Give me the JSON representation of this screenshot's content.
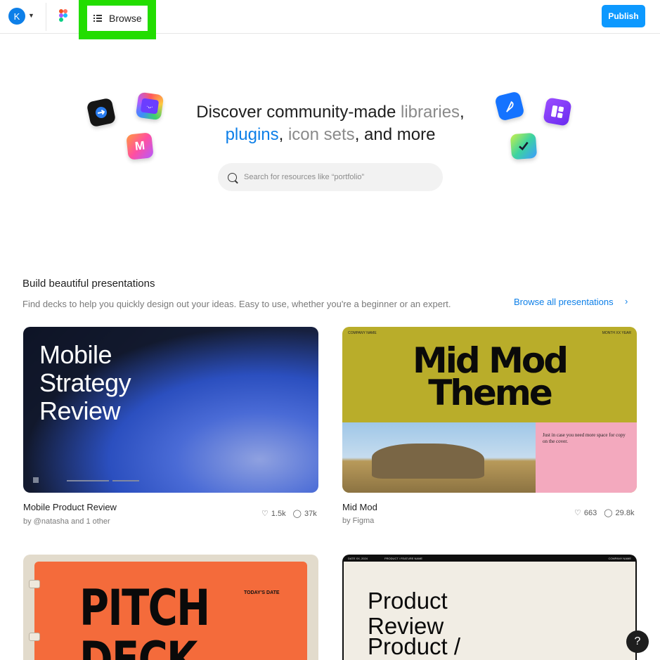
{
  "topbar": {
    "avatar_letter": "K",
    "browse_label": "Browse",
    "publish_label": "Publish"
  },
  "hero": {
    "title_part1": "Discover community-made ",
    "title_libraries": "libraries",
    "title_comma1": ",",
    "title_plugins": "plugins",
    "title_comma2": ", ",
    "title_iconsets": "icon sets",
    "title_end": ", and more",
    "search_placeholder": "Search for resources like “portfolio”"
  },
  "section": {
    "title": "Build beautiful presentations",
    "description": "Find decks to help you quickly design out your ideas. Easy to use, whether you're a beginner or an expert.",
    "browse_all": "Browse all presentations"
  },
  "cards": [
    {
      "name": "Mobile Product Review",
      "author": "by @natasha and 1 other",
      "likes": "1.5k",
      "users": "37k",
      "thumb_lines": [
        "Mobile",
        "Strategy",
        "Review"
      ]
    },
    {
      "name": "Mid Mod",
      "author": "by Figma",
      "likes": "663",
      "users": "29.8k",
      "thumb_company": "COMPANY NAME",
      "thumb_month": "MONTH XX YEAR",
      "thumb_line1": "Mid Mod",
      "thumb_line2": "Theme",
      "thumb_caption": "Just in case you need more space for copy on the cover."
    },
    {
      "thumb_line1": "PITCH",
      "thumb_line2": "DECK",
      "thumb_date": "TODAY'S DATE"
    },
    {
      "thumb_date": "DATE XX, 2024",
      "thumb_feature": "PRODUCT / FEATURE NAME",
      "thumb_company": "COMPANY NAME",
      "thumb_line1": "Product",
      "thumb_line2": "Review",
      "thumb_line3": "Product /"
    }
  ],
  "help_label": "?",
  "colors": {
    "accent": "#0d7fe8",
    "publish": "#0d99ff",
    "highlight": "#22dd00"
  }
}
